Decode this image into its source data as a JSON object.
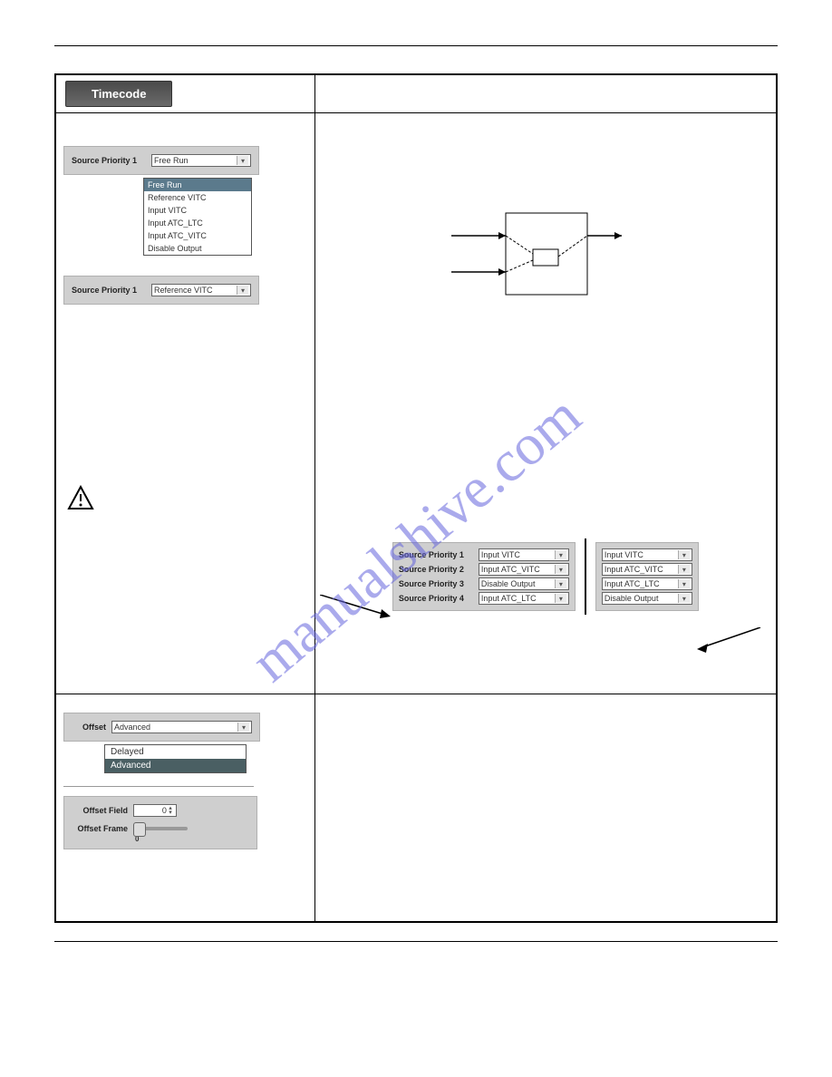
{
  "header_tab": "Timecode",
  "priority_open": {
    "label": "Source Priority 1",
    "selected": "Free Run",
    "options": [
      "Free Run",
      "Reference VITC",
      "Input VITC",
      "Input ATC_LTC",
      "Input ATC_VITC",
      "Disable Output"
    ]
  },
  "priority_closed": {
    "label": "Source Priority 1",
    "value": "Reference VITC"
  },
  "example_left": {
    "rows": [
      {
        "label": "Source Priority 1",
        "value": "Input VITC"
      },
      {
        "label": "Source Priority 2",
        "value": "Input ATC_VITC"
      },
      {
        "label": "Source Priority 3",
        "value": "Disable Output"
      },
      {
        "label": "Source Priority 4",
        "value": "Input ATC_LTC"
      }
    ]
  },
  "example_right": {
    "rows": [
      {
        "value": "Input VITC"
      },
      {
        "value": "Input ATC_VITC"
      },
      {
        "value": "Input ATC_LTC"
      },
      {
        "value": "Disable Output"
      }
    ]
  },
  "offset": {
    "label": "Offset",
    "selected": "Advanced",
    "options": [
      "Delayed",
      "Advanced"
    ]
  },
  "offset_field": {
    "label": "Offset Field",
    "value": "0"
  },
  "offset_frame": {
    "label": "Offset Frame",
    "tick": "0"
  },
  "watermark": "manualshive.com"
}
